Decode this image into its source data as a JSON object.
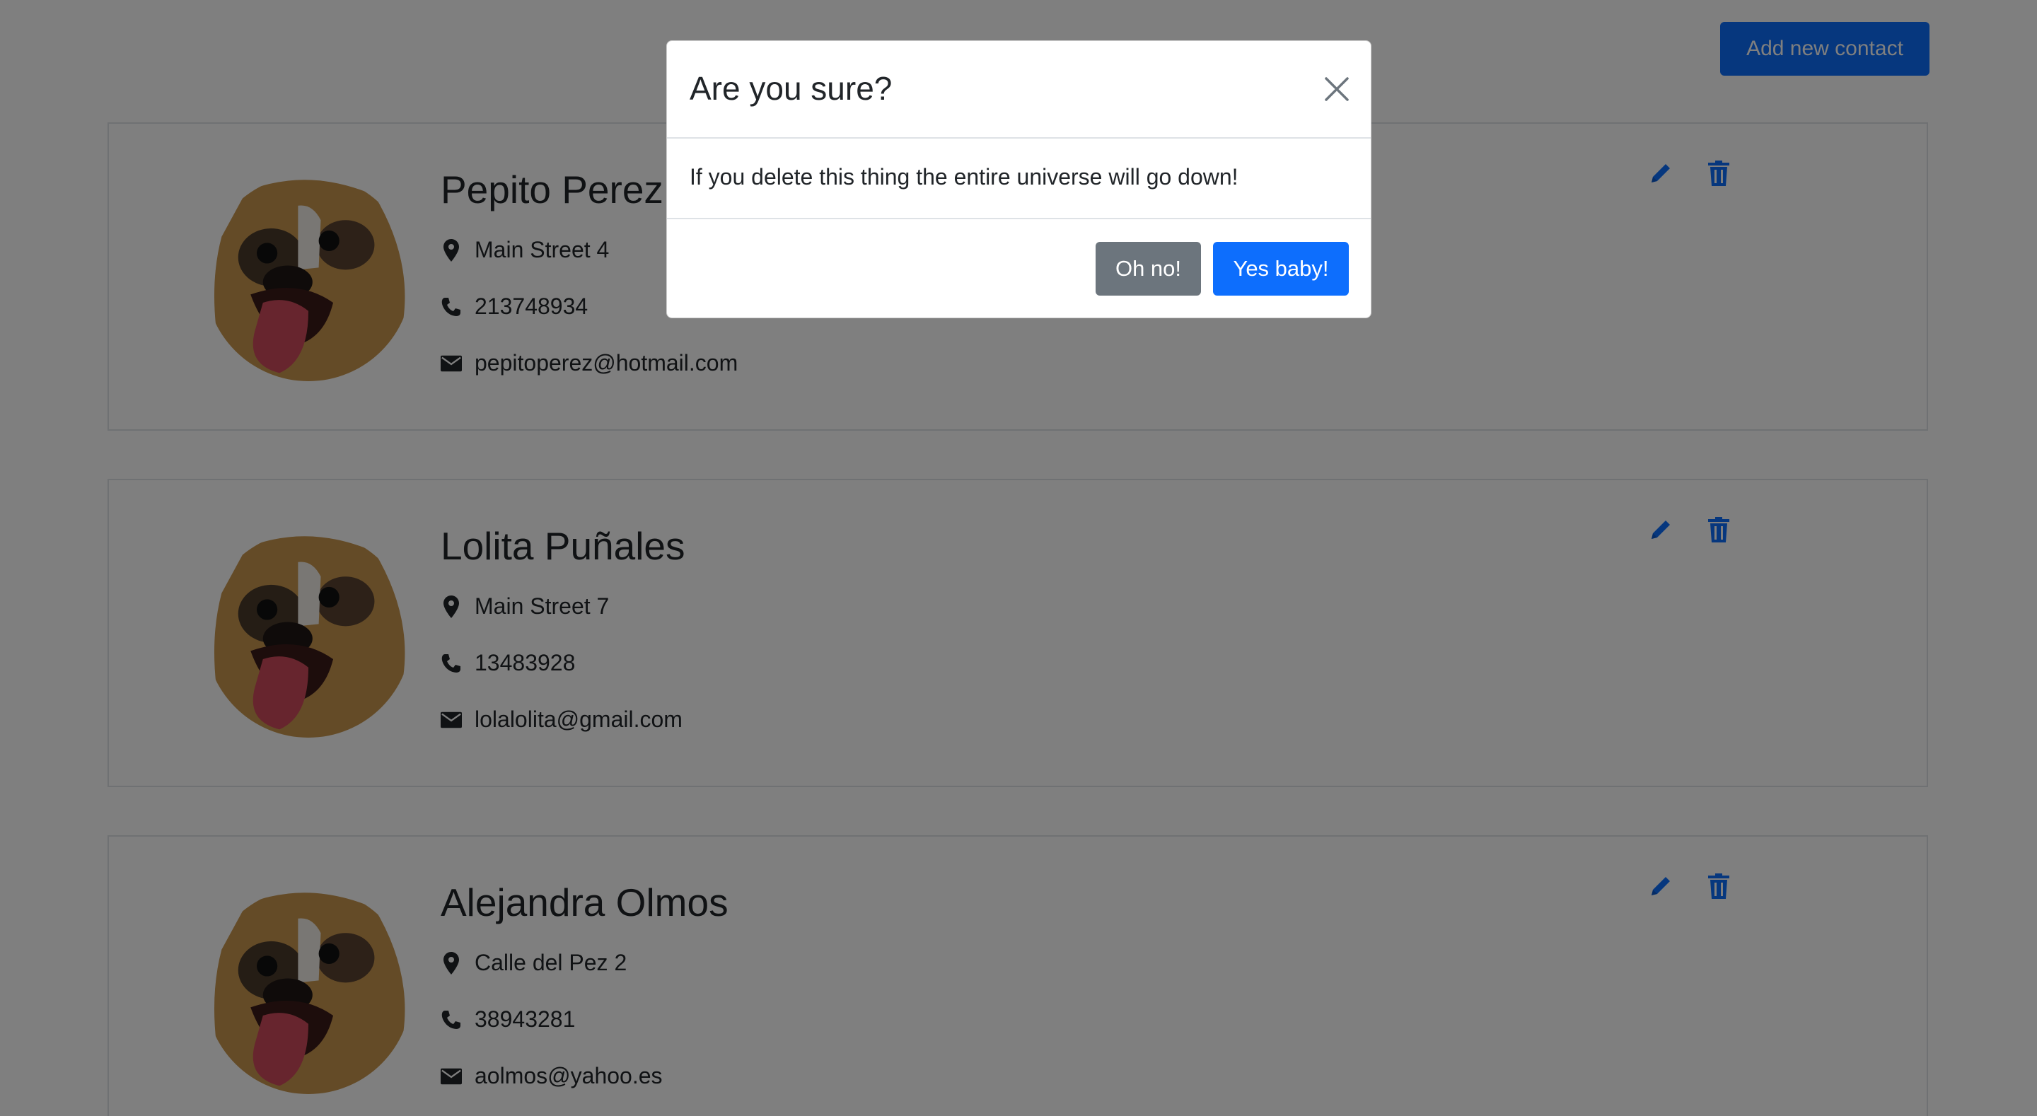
{
  "header": {
    "add_button_label": "Add new contact"
  },
  "contacts": [
    {
      "name": "Pepito Perez",
      "address": "Main Street 4",
      "phone": "213748934",
      "email": "pepitoperez@hotmail.com"
    },
    {
      "name": "Lolita Puñales",
      "address": "Main Street 7",
      "phone": "13483928",
      "email": "lolalolita@gmail.com"
    },
    {
      "name": "Alejandra Olmos",
      "address": "Calle del Pez 2",
      "phone": "38943281",
      "email": "aolmos@yahoo.es"
    }
  ],
  "modal": {
    "title": "Are you sure?",
    "body": "If you delete this thing the entire universe will go down!",
    "cancel_label": "Oh no!",
    "confirm_label": "Yes baby!"
  },
  "icons": {
    "address": "map-marker-icon",
    "phone": "phone-icon",
    "email": "envelope-icon",
    "edit": "pencil-icon",
    "delete": "trash-icon",
    "close": "close-icon",
    "avatar": "dog-avatar"
  },
  "colors": {
    "primary": "#0d6efd",
    "secondary": "#6c757d",
    "overlay": "rgba(0,0,0,0.5)",
    "text": "#212529"
  }
}
